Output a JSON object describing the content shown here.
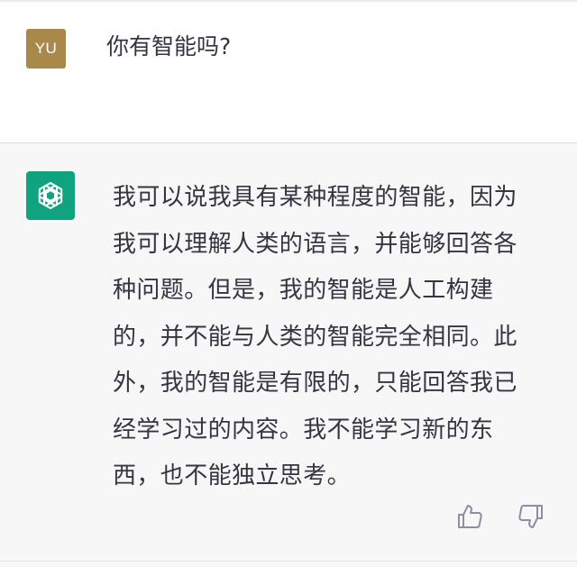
{
  "user_message": {
    "avatar_initials": "YU",
    "avatar_color": "#a9894a",
    "text": "你有智能吗?"
  },
  "assistant_message": {
    "avatar_icon": "openai-logo-icon",
    "avatar_color": "#10a37f",
    "lines": [
      "我可以说我具有某种程度的智能，因为",
      "我可以理解人类的语言，并能够回答各",
      "种问题。但是，我的智能是人工构建",
      "的，并不能与人类的智能完全相同。此",
      "外，我的智能是有限的，只能回答我已",
      "经学习过的内容。我不能学习新的东",
      "西，也不能独立思考。"
    ]
  },
  "feedback": {
    "thumbs_up_icon": "thumbs-up-icon",
    "thumbs_down_icon": "thumbs-down-icon"
  }
}
